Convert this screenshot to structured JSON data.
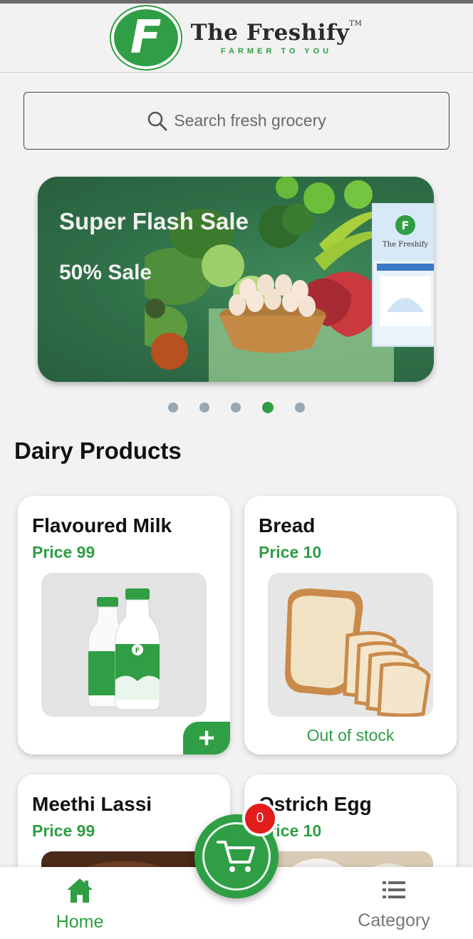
{
  "header": {
    "brand_name": "The Freshify",
    "trademark": "TM",
    "tagline": "FARMER TO YOU",
    "logo_letter": "F"
  },
  "search": {
    "placeholder": "Search fresh grocery",
    "icon": "search-icon"
  },
  "banner": {
    "title": "Super Flash Sale",
    "subtitle": "50% Sale",
    "pack_brand": "The Freshify"
  },
  "carousel": {
    "count": 5,
    "active_index": 3
  },
  "section": {
    "title": "Dairy Products"
  },
  "products": [
    {
      "name": "Flavoured Milk",
      "price": "Price 99",
      "status": "",
      "action": "+"
    },
    {
      "name": "Bread",
      "price": "Price 10",
      "status": "Out of stock"
    },
    {
      "name": "Meethi Lassi",
      "price": "Price 99"
    },
    {
      "name": "Ostrich Egg",
      "price": "Price 10"
    }
  ],
  "cart": {
    "count": "0",
    "icon": "cart-icon"
  },
  "bottom_nav": {
    "home_label": "Home",
    "category_label": "Category"
  },
  "colors": {
    "brand_green": "#2f9e44",
    "badge_red": "#e21b1b",
    "background": "#f2f2f2"
  }
}
